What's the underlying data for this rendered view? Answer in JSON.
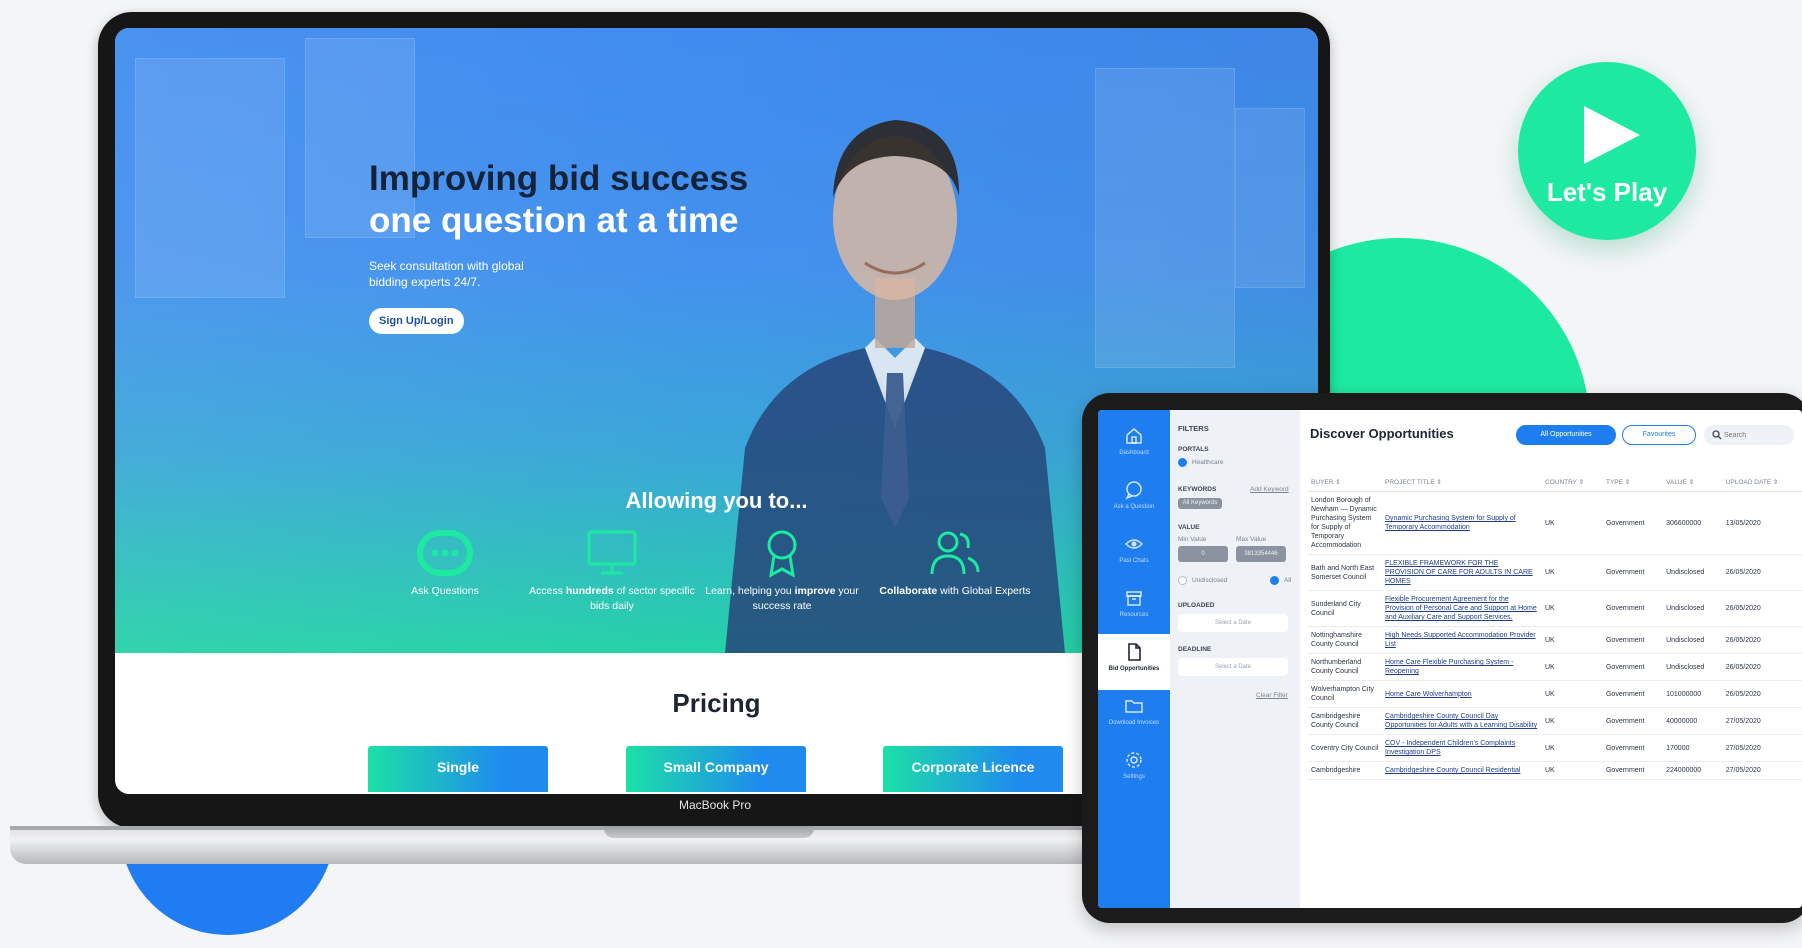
{
  "play_button": {
    "label": "Let's Play"
  },
  "laptop": {
    "brand": "MacBook Pro",
    "hero": {
      "title_line1": "Improving bid success",
      "title_line2": "one question at a time",
      "subtitle": "Seek consultation with global bidding experts 24/7.",
      "cta": "Sign Up/Login",
      "allowing": "Allowing you to..."
    },
    "features": [
      {
        "icon": "chat-bubble-icon",
        "pre": "Ask Questions",
        "bold": "",
        "post": ""
      },
      {
        "icon": "monitor-icon",
        "pre": "Access ",
        "bold": "hundreds",
        "post": " of sector specific bids daily"
      },
      {
        "icon": "award-ribbon-icon",
        "pre": "Learn, helping you ",
        "bold": "improve",
        "post": " your success rate"
      },
      {
        "icon": "people-icon",
        "pre": "",
        "bold": "Collaborate",
        "post": " with Global Experts"
      }
    ],
    "pricing": {
      "title": "Pricing",
      "cards": [
        "Single",
        "Small Company",
        "Corporate Licence"
      ]
    }
  },
  "tablet": {
    "nav": [
      {
        "label": "Dashboard",
        "icon": "home-icon"
      },
      {
        "label": "Ask a Question",
        "icon": "chat-icon"
      },
      {
        "label": "Past Chats",
        "icon": "eye-icon"
      },
      {
        "label": "Resources",
        "icon": "archive-icon"
      },
      {
        "label": "Bid Opportunities",
        "icon": "document-icon"
      },
      {
        "label": "Download Invoices",
        "icon": "folder-icon"
      },
      {
        "label": "Settings",
        "icon": "gear-icon"
      }
    ],
    "filters": {
      "heading": "FILTERS",
      "portals_label": "PORTALS",
      "portal_value": "Healthcare",
      "keywords_label": "KEYWORDS",
      "add_keyword": "Add Keyword",
      "keyword_chip": "All Keywords",
      "value_label": "VALUE",
      "min_label": "Min Value",
      "max_label": "Max Value",
      "min_value": "0",
      "max_value": "3813354446",
      "undisclosed": "Undisclosed",
      "all": "All",
      "uploaded_label": "UPLOADED",
      "uploaded_placeholder": "Select a Date",
      "deadline_label": "DEADLINE",
      "deadline_placeholder": "Select a Date",
      "clear": "Clear Filter"
    },
    "main": {
      "title": "Discover Opportunities",
      "tab_all": "All Opportunities",
      "tab_fav": "Favourites",
      "search_placeholder": "Search",
      "columns": [
        "BUYER ⇕",
        "PROJECT TITLE ⇕",
        "COUNTRY ⇕",
        "TYPE ⇕",
        "VALUE ⇕",
        "UPLOAD DATE ⇕"
      ],
      "rows": [
        [
          "London Borough of Newham — Dynamic Purchasing System for Supply of Temporary Accommodation",
          "Dynamic Purchasing System for Supply of Temporary Accommodation",
          "UK",
          "Government",
          "306600000",
          "13/05/2020"
        ],
        [
          "Bath and North East Somerset Council",
          "FLEXIBLE FRAMEWORK FOR THE PROVISION OF CARE FOR ADULTS IN CARE HOMES",
          "UK",
          "Government",
          "Undisclosed",
          "26/05/2020"
        ],
        [
          "Sunderland City Council",
          "Flexible Procurement Agreement for the Provision of Personal Care and Support at Home and Auxiliary Care and Support Services.",
          "UK",
          "Government",
          "Undisclosed",
          "26/05/2020"
        ],
        [
          "Nottinghamshire County Council",
          "High Needs Supported Accommodation Provider List",
          "UK",
          "Government",
          "Undisclosed",
          "26/05/2020"
        ],
        [
          "Northumberland County Council",
          "Home Care Flexible Purchasing System - Reopening",
          "UK",
          "Government",
          "Undisclosed",
          "26/05/2020"
        ],
        [
          "Wolverhampton City Council",
          "Home Care Wolverhampton",
          "UK",
          "Government",
          "101000000",
          "26/05/2020"
        ],
        [
          "Cambridgeshire County Council",
          "Cambridgeshire County Council Day Opportunities for Adults with a Learning Disability",
          "UK",
          "Government",
          "40000000",
          "27/05/2020"
        ],
        [
          "Coventry City Council",
          "COV - Independent Children’s Complaints Investigation DPS",
          "UK",
          "Government",
          "170000",
          "27/05/2020"
        ],
        [
          "Cambridgeshire",
          "Cambridgeshire County Council Residential",
          "UK",
          "Government",
          "224000000",
          "27/05/2020"
        ]
      ]
    }
  },
  "colors": {
    "brand_blue": "#1e7ef0",
    "brand_green": "#1de9a0",
    "hero_dark_text": "#14233a"
  }
}
